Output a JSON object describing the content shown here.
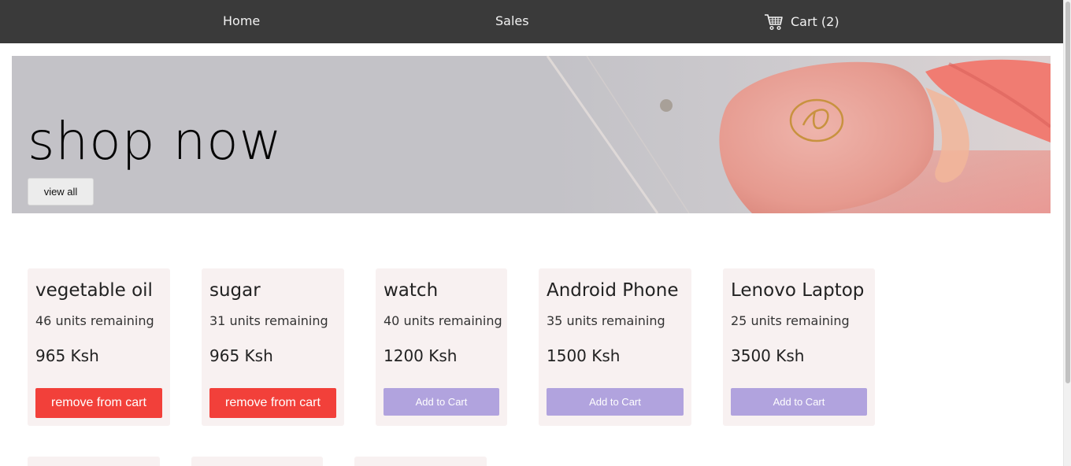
{
  "nav": {
    "home": "Home",
    "sales": "Sales",
    "cart": "Cart (2)"
  },
  "hero": {
    "title": "shop now",
    "button": "view all"
  },
  "products": [
    {
      "name": "vegetable oil",
      "stock": "46 units remaining",
      "price": "965 Ksh",
      "action": "remove from cart"
    },
    {
      "name": "sugar",
      "stock": "31 units remaining",
      "price": "965 Ksh",
      "action": "remove from cart"
    },
    {
      "name": "watch",
      "stock": "40 units remaining",
      "price": "1200 Ksh",
      "action": "Add to Cart"
    },
    {
      "name": "Android Phone",
      "stock": "35 units remaining",
      "price": "1500 Ksh",
      "action": "Add to Cart"
    },
    {
      "name": "Lenovo Laptop",
      "stock": "25 units remaining",
      "price": "3500 Ksh",
      "action": "Add to Cart"
    }
  ],
  "colors": {
    "navbar": "#3a3a3a",
    "hero_bg": "#c3c2c7",
    "card_bg": "#f8f1f1",
    "remove_button": "#f2403a",
    "add_button": "#b1a3de"
  },
  "icons": {
    "cart": "shopping-cart-icon"
  }
}
